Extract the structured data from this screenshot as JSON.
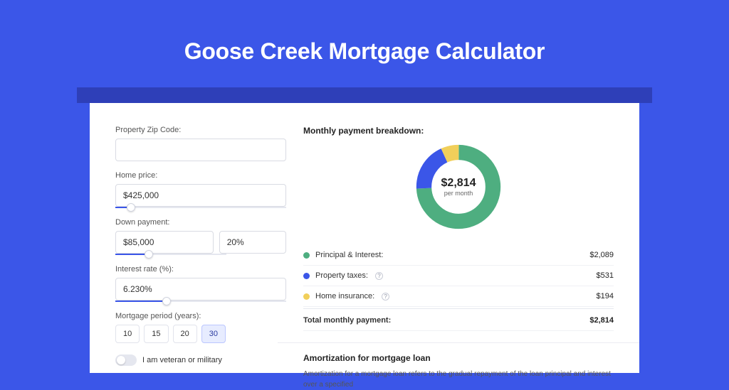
{
  "page": {
    "title": "Goose Creek Mortgage Calculator"
  },
  "form": {
    "zip_label": "Property Zip Code:",
    "zip_value": "",
    "home_price_label": "Home price:",
    "home_price_value": "$425,000",
    "home_price_slider_pct": 9,
    "down_payment_label": "Down payment:",
    "down_payment_value": "$85,000",
    "down_payment_pct_value": "20%",
    "down_payment_slider_pct": 20,
    "interest_label": "Interest rate (%):",
    "interest_value": "6.230%",
    "interest_slider_pct": 30,
    "period_label": "Mortgage period (years):",
    "period_options": [
      "10",
      "15",
      "20",
      "30"
    ],
    "period_selected": "30",
    "veteran_label": "I am veteran or military",
    "veteran_checked": false
  },
  "breakdown": {
    "title": "Monthly payment breakdown:",
    "center_amount": "$2,814",
    "center_sub": "per month",
    "items": [
      {
        "label": "Principal & Interest:",
        "value": "$2,089",
        "color": "green",
        "help": false
      },
      {
        "label": "Property taxes:",
        "value": "$531",
        "color": "blue",
        "help": true
      },
      {
        "label": "Home insurance:",
        "value": "$194",
        "color": "yellow",
        "help": true
      }
    ],
    "total_label": "Total monthly payment:",
    "total_value": "$2,814"
  },
  "chart_data": {
    "type": "pie",
    "title": "Monthly payment breakdown",
    "series": [
      {
        "name": "Principal & Interest",
        "value": 2089,
        "color": "#4eae80"
      },
      {
        "name": "Property taxes",
        "value": 531,
        "color": "#3b56e8"
      },
      {
        "name": "Home insurance",
        "value": 194,
        "color": "#f1cf5a"
      }
    ],
    "total": 2814,
    "inner_radius_ratio": 0.62
  },
  "amortization": {
    "title": "Amortization for mortgage loan",
    "text": "Amortization for a mortgage loan refers to the gradual repayment of the loan principal and interest over a specified"
  }
}
